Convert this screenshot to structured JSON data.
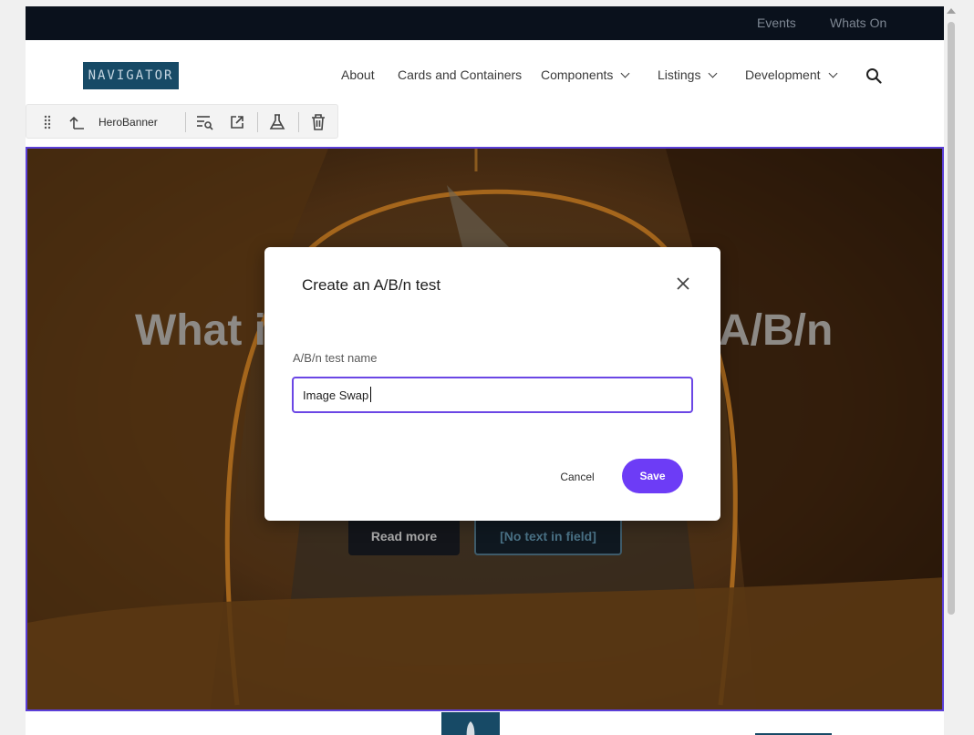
{
  "topbar": {
    "links": [
      "Events",
      "Whats On"
    ]
  },
  "nav": {
    "logo": "NAVIGATOR",
    "items": [
      {
        "label": "About",
        "has_dropdown": false
      },
      {
        "label": "Cards and Containers",
        "has_dropdown": false
      },
      {
        "label": "Components",
        "has_dropdown": true
      },
      {
        "label": "Listings",
        "has_dropdown": true
      },
      {
        "label": "Development",
        "has_dropdown": true
      }
    ],
    "search_icon": "search-icon"
  },
  "edit_toolbar": {
    "component_name": "HeroBanner",
    "icons": [
      "drag-handle-icon",
      "select-parent-icon",
      "filter-search-icon",
      "open-external-icon",
      "ab-test-flask-icon",
      "delete-icon"
    ]
  },
  "hero": {
    "title_left": "What i",
    "title_right": "A/B/n",
    "read_more": "Read more",
    "empty_field": "[No text in field]"
  },
  "dialog": {
    "title": "Create an A/B/n test",
    "field_label": "A/B/n test name",
    "field_value": "Image Swap",
    "cancel_label": "Cancel",
    "save_label": "Save"
  },
  "colors": {
    "accent": "#6d3cf6",
    "brand": "#174a66",
    "topbar": "#0a111c"
  }
}
